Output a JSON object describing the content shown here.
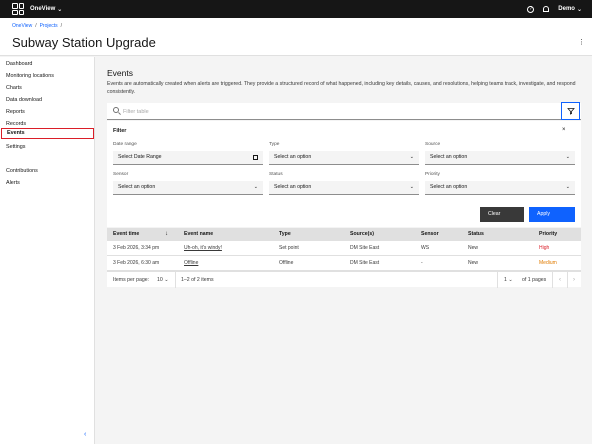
{
  "header": {
    "app_name": "OneView",
    "user_name": "Demo"
  },
  "breadcrumb": [
    "OneView",
    "Projects"
  ],
  "page_title": "Subway Station Upgrade",
  "sidebar": {
    "items": [
      {
        "label": "Dashboard"
      },
      {
        "label": "Monitoring locations"
      },
      {
        "label": "Charts"
      },
      {
        "label": "Data download"
      },
      {
        "label": "Reports"
      },
      {
        "label": "Records"
      },
      {
        "label": "Events"
      },
      {
        "label": "Settings"
      },
      {
        "label": "Contributions"
      },
      {
        "label": "Alerts"
      }
    ],
    "active": "Events"
  },
  "events": {
    "title": "Events",
    "description": "Events are automatically created when alerts are triggered. They provide a structured record of what happened, including key details, causes, and resolutions, helping teams track, investigate, and respond consistently."
  },
  "search": {
    "placeholder": "Filter table"
  },
  "filter": {
    "title": "Filter",
    "fields": [
      {
        "label": "Date range",
        "value": "Select Date Range"
      },
      {
        "label": "Type",
        "value": "Select an option"
      },
      {
        "label": "Source",
        "value": "Select an option"
      },
      {
        "label": "Sensor",
        "value": "Select an option"
      },
      {
        "label": "Status",
        "value": "Select an option"
      },
      {
        "label": "Priority",
        "value": "Select an option"
      }
    ],
    "clear_label": "Clear",
    "apply_label": "Apply"
  },
  "table": {
    "columns": [
      "Event time",
      "Event name",
      "Type",
      "Source(s)",
      "Sensor",
      "Status",
      "Priority"
    ],
    "rows": [
      [
        "3 Feb 2026, 3:34 pm",
        "Uh-oh, it's windy!",
        "Set point",
        "DM Site East",
        "WS",
        "New",
        "High"
      ],
      [
        "3 Feb 2026, 6:30 am",
        "Offline",
        "Offline",
        "DM Site East",
        "-",
        "New",
        "Medium"
      ]
    ]
  },
  "pagination": {
    "items_per_page_label": "Items per page:",
    "items_per_page": "10",
    "range_text": "1–2 of 2 items",
    "page": "1",
    "pages_text": "of 1 pages"
  },
  "colors": {
    "accent": "#0f62fe",
    "link": "#8a3ffc",
    "priority_high": "#da1e28",
    "priority_medium": "#e07b00",
    "active_outline": "#da1e28"
  }
}
